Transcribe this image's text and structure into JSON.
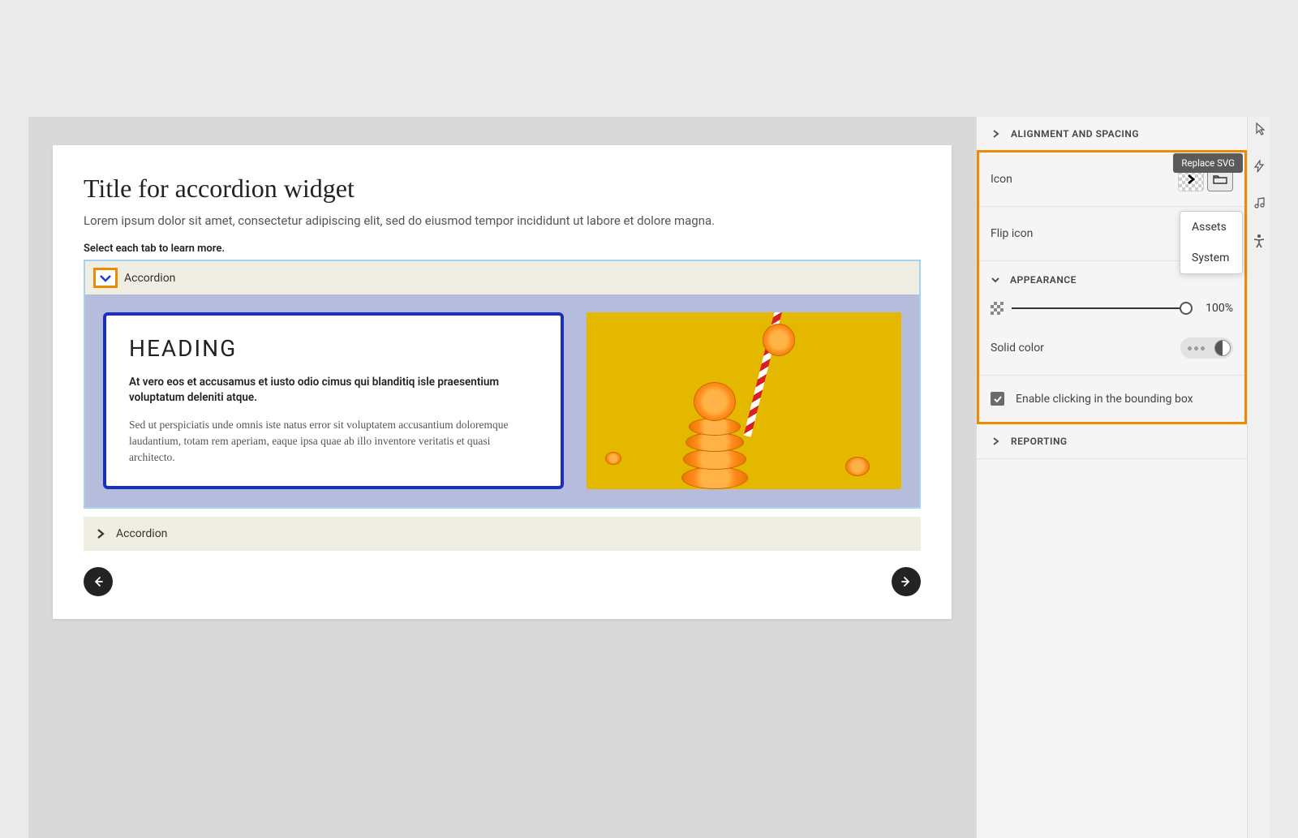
{
  "canvas": {
    "title": "Title for accordion widget",
    "subtitle": "Lorem ipsum dolor sit amet, consectetur adipiscing elit, sed do eiusmod tempor incididunt ut labore et dolore magna.",
    "instruction": "Select each tab to learn more.",
    "accordion1_label": "Accordion",
    "card_heading": "HEADING",
    "card_bold": "At vero eos et accusamus et iusto odio cimus qui blanditiq isle praesentium voluptatum deleniti atque.",
    "card_body": "Sed ut perspiciatis unde omnis iste natus error sit voluptatem accusantium doloremque laudantium, totam rem aperiam, eaque ipsa quae ab illo inventore veritatis et quasi architecto.",
    "accordion2_label": "Accordion"
  },
  "panel": {
    "section_alignment": "ALIGNMENT AND SPACING",
    "icon_label": "Icon",
    "tooltip": "Replace SVG",
    "dropdown": {
      "assets": "Assets",
      "system": "System"
    },
    "flip_label": "Flip icon",
    "appearance_label": "APPEARANCE",
    "opacity_value": "100%",
    "solid_label": "Solid color",
    "enable_label": "Enable clicking in the bounding box",
    "section_reporting": "REPORTING"
  }
}
